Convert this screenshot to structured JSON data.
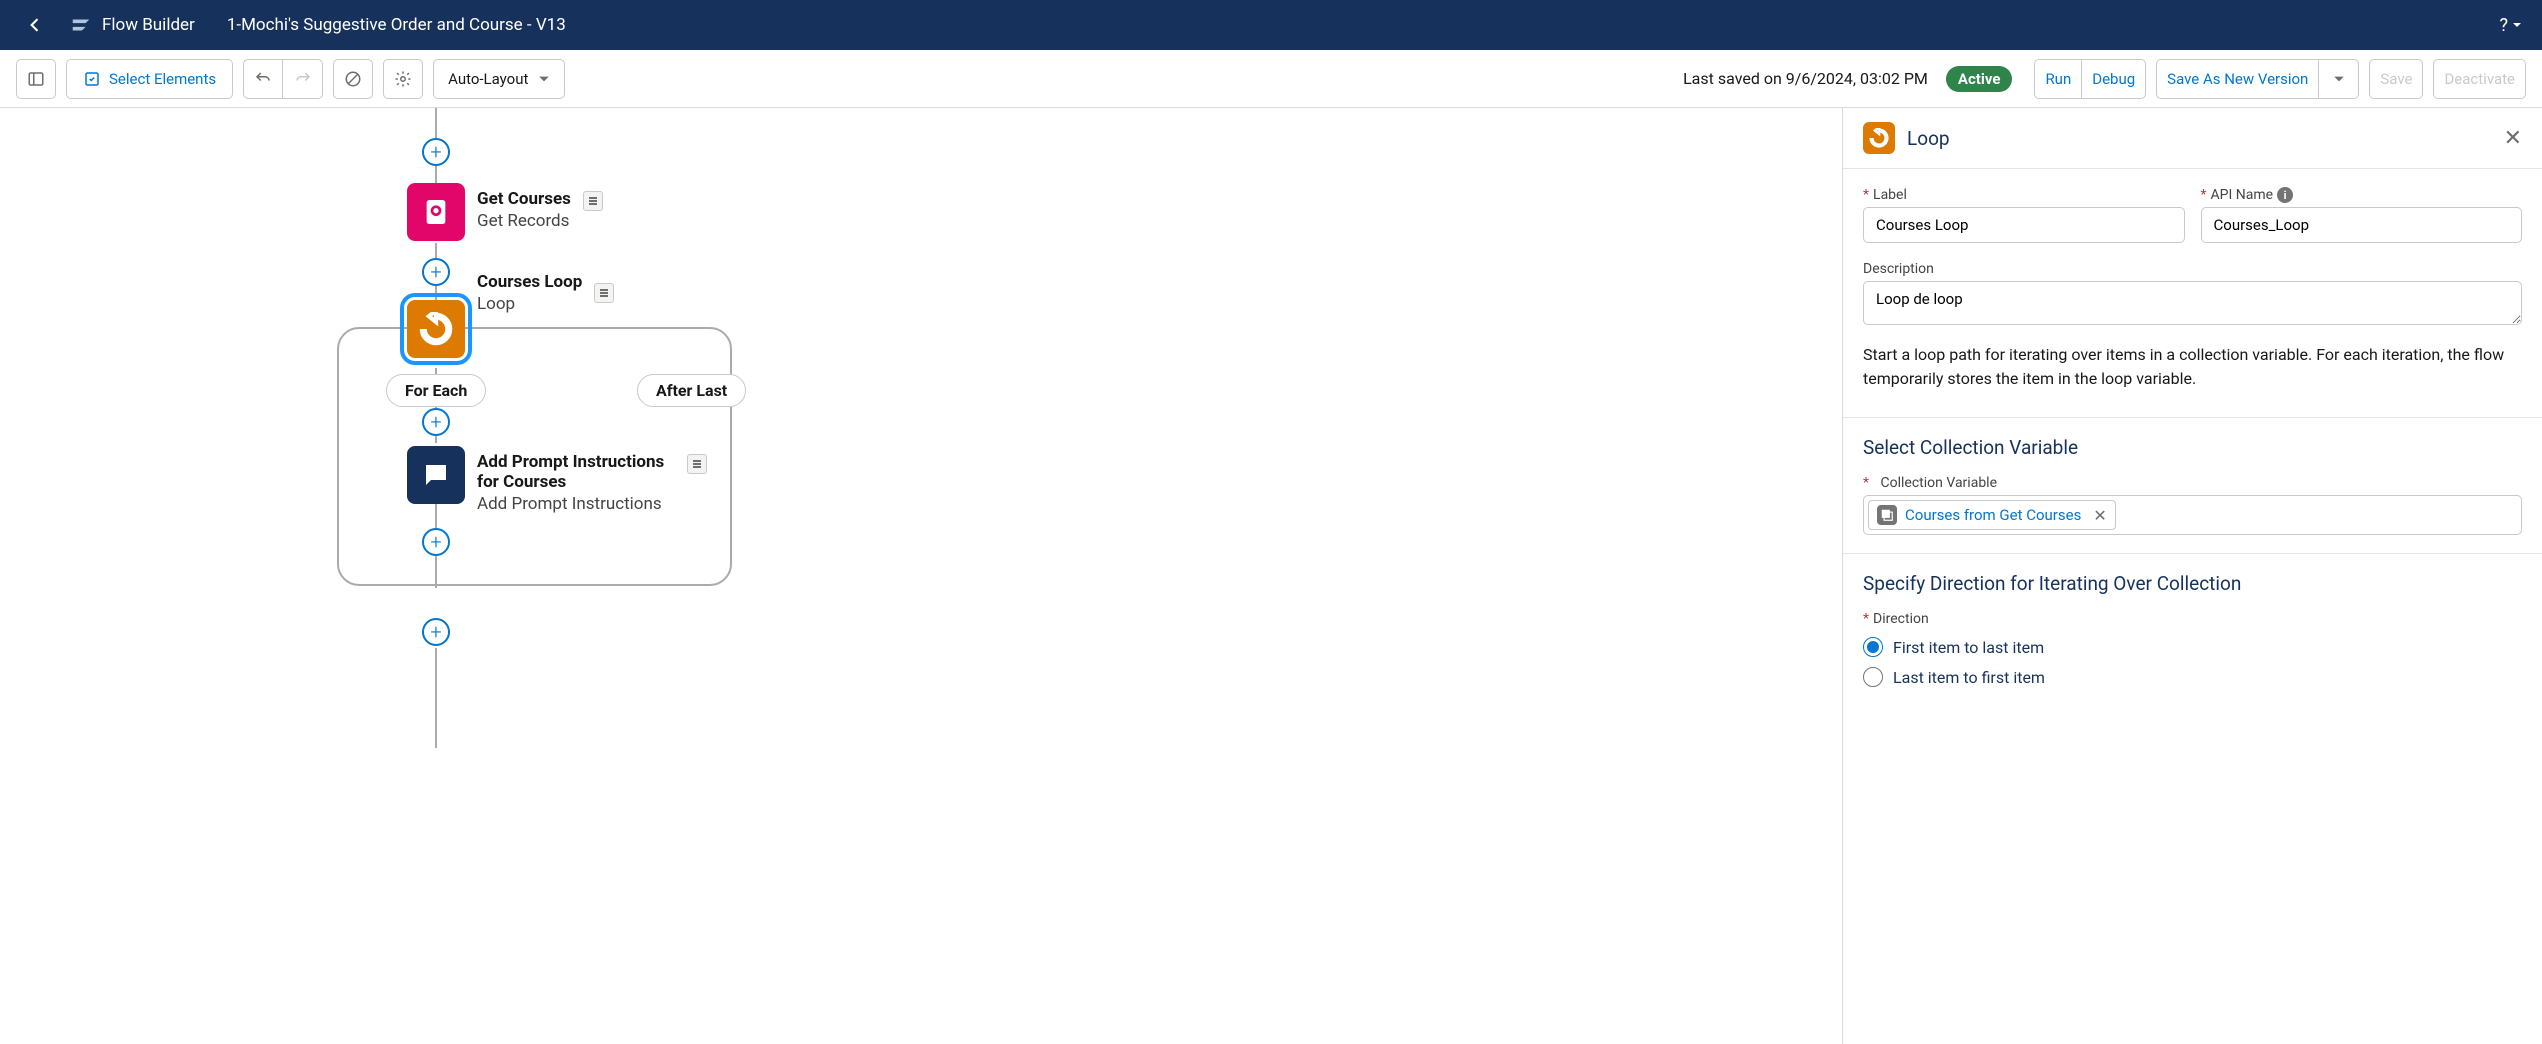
{
  "header": {
    "app_name": "Flow Builder",
    "flow_name": "1-Mochi's Suggestive Order and Course - V13"
  },
  "toolbar": {
    "select_elements": "Select Elements",
    "auto_layout": "Auto-Layout",
    "last_saved": "Last saved on 9/6/2024, 03:02 PM",
    "status_badge": "Active",
    "run": "Run",
    "debug": "Debug",
    "save_as_new": "Save As New Version",
    "save": "Save",
    "deactivate": "Deactivate"
  },
  "canvas": {
    "nodes": {
      "get_courses": {
        "title": "Get Courses",
        "subtitle": "Get Records"
      },
      "courses_loop": {
        "title": "Courses Loop",
        "subtitle": "Loop"
      },
      "add_prompt": {
        "title": "Add Prompt Instructions for Courses",
        "subtitle": "Add Prompt Instructions"
      }
    },
    "pills": {
      "for_each": "For Each",
      "after_last": "After Last"
    }
  },
  "panel": {
    "title": "Loop",
    "labels": {
      "label": "Label",
      "api_name": "API Name",
      "description": "Description",
      "collection_variable": "Collection Variable",
      "direction": "Direction"
    },
    "values": {
      "label": "Courses Loop",
      "api_name": "Courses_Loop",
      "description": "Loop de loop",
      "collection_token": "Courses from Get Courses"
    },
    "help_text": "Start a loop path for iterating over items in a collection variable. For each iteration, the flow temporarily stores the item in the loop variable.",
    "sections": {
      "select_collection": "Select Collection Variable",
      "specify_direction": "Specify Direction for Iterating Over Collection"
    },
    "radios": {
      "first_to_last": "First item to last item",
      "last_to_first": "Last item to first item"
    }
  }
}
